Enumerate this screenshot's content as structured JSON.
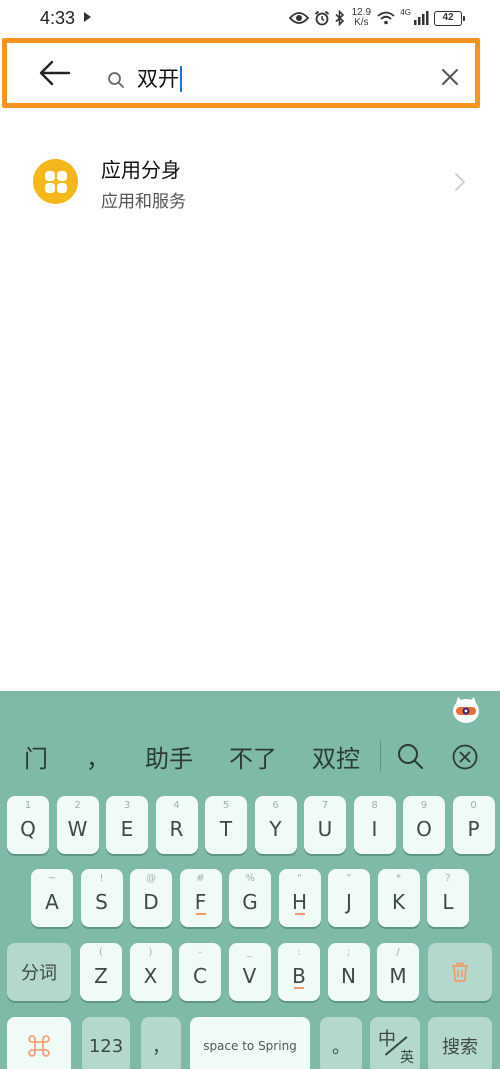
{
  "status_bar": {
    "time": "4:33",
    "net_speed_value": "12.9",
    "net_speed_unit": "K/s",
    "network_type": "4G",
    "battery": "42"
  },
  "search": {
    "query": "双开"
  },
  "results": [
    {
      "title": "应用分身",
      "subtitle": "应用和服务"
    }
  ],
  "keyboard": {
    "candidates": [
      "门",
      "，",
      "助手",
      "不了",
      "双控"
    ],
    "row1": [
      {
        "main": "Q",
        "hint": "1"
      },
      {
        "main": "W",
        "hint": "2"
      },
      {
        "main": "E",
        "hint": "3"
      },
      {
        "main": "R",
        "hint": "4"
      },
      {
        "main": "T",
        "hint": "5"
      },
      {
        "main": "Y",
        "hint": "6"
      },
      {
        "main": "U",
        "hint": "7"
      },
      {
        "main": "I",
        "hint": "8"
      },
      {
        "main": "O",
        "hint": "9"
      },
      {
        "main": "P",
        "hint": "0"
      }
    ],
    "row2": [
      {
        "main": "A",
        "hint": "~"
      },
      {
        "main": "S",
        "hint": "!"
      },
      {
        "main": "D",
        "hint": "@"
      },
      {
        "main": "F",
        "hint": "#"
      },
      {
        "main": "G",
        "hint": "%"
      },
      {
        "main": "H",
        "hint": "“"
      },
      {
        "main": "J",
        "hint": "”"
      },
      {
        "main": "K",
        "hint": "*"
      },
      {
        "main": "L",
        "hint": "?"
      }
    ],
    "row3": [
      {
        "main": "Z",
        "hint": "("
      },
      {
        "main": "X",
        "hint": ")"
      },
      {
        "main": "C",
        "hint": "-"
      },
      {
        "main": "V",
        "hint": "_"
      },
      {
        "main": "B",
        "hint": ":"
      },
      {
        "main": "N",
        "hint": ";"
      },
      {
        "main": "M",
        "hint": "/"
      }
    ],
    "segment_label": "分词",
    "numbers_label": "123",
    "comma_label": "，",
    "space_label": "space to Spring",
    "period_label": "。",
    "lang_primary": "中",
    "lang_secondary": "英",
    "search_label": "搜索"
  },
  "colors": {
    "highlight_border": "#f79420",
    "keyboard_bg": "#7fb9a8",
    "app_icon": "#f5b81b",
    "caret": "#1a73e8"
  },
  "icons": [
    "play-icon",
    "eye-icon",
    "alarm-icon",
    "bluetooth-icon",
    "wifi-icon",
    "signal-icon",
    "battery-icon",
    "back-arrow-icon",
    "search-icon",
    "clear-icon",
    "app-clone-icon",
    "chevron-right-icon",
    "keyboard-mascot-icon",
    "candidate-search-icon",
    "candidate-close-icon",
    "command-icon",
    "delete-icon"
  ]
}
